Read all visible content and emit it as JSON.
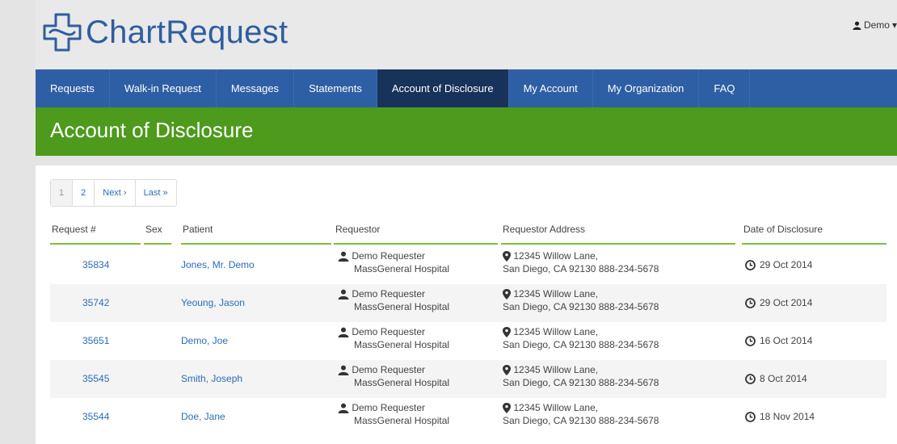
{
  "brand": {
    "name": "ChartRequest",
    "color": "#2f5da0"
  },
  "user": {
    "name": "Demo"
  },
  "nav": {
    "items": [
      {
        "label": "Requests"
      },
      {
        "label": "Walk-in Request"
      },
      {
        "label": "Messages"
      },
      {
        "label": "Statements"
      },
      {
        "label": "Account of Disclosure",
        "active": true
      },
      {
        "label": "My Account"
      },
      {
        "label": "My Organization"
      },
      {
        "label": "FAQ"
      }
    ]
  },
  "page": {
    "title": "Account of Disclosure"
  },
  "pager": {
    "items": [
      "1",
      "2",
      "Next ›",
      "Last »"
    ],
    "current": "1"
  },
  "table": {
    "headers": {
      "request": "Request #",
      "sex": "Sex",
      "patient": "Patient",
      "requestor": "Requestor",
      "address": "Requestor Address",
      "date": "Date of Disclosure"
    },
    "rows": [
      {
        "request": "35834",
        "patient": "Jones, Mr. Demo",
        "requestor": "Demo Requester",
        "org": "MassGeneral Hospital",
        "addr1": "12345 Willow Lane,",
        "addr2": "San Diego, CA 92130 888-234-5678",
        "date": "29 Oct 2014"
      },
      {
        "request": "35742",
        "patient": "Yeoung, Jason",
        "requestor": "Demo Requester",
        "org": "MassGeneral Hospital",
        "addr1": "12345 Willow Lane,",
        "addr2": "San Diego, CA 92130 888-234-5678",
        "date": "29 Oct 2014"
      },
      {
        "request": "35651",
        "patient": "Demo, Joe",
        "requestor": "Demo Requester",
        "org": "MassGeneral Hospital",
        "addr1": "12345 Willow Lane,",
        "addr2": "San Diego, CA 92130 888-234-5678",
        "date": "16 Oct 2014"
      },
      {
        "request": "35545",
        "patient": "Smith, Joseph",
        "requestor": "Demo Requester",
        "org": "MassGeneral Hospital",
        "addr1": "12345 Willow Lane,",
        "addr2": "San Diego, CA 92130 888-234-5678",
        "date": "8 Oct 2014"
      },
      {
        "request": "35544",
        "patient": "Doe, Jane",
        "requestor": "Demo Requester",
        "org": "MassGeneral Hospital",
        "addr1": "12345 Willow Lane,",
        "addr2": "San Diego, CA 92130 888-234-5678",
        "date": "18 Nov 2014"
      }
    ]
  },
  "colors": {
    "nav": "#2e5fa4",
    "nav_active": "#18335a",
    "banner": "#4d9a1c",
    "link": "#2a6db5",
    "header_rule": "#7cbf3f"
  },
  "icons": {
    "logo": "medical-cross-icon",
    "user": "user-icon",
    "requestor": "user-icon",
    "address": "map-marker-icon",
    "date": "clock-icon"
  }
}
